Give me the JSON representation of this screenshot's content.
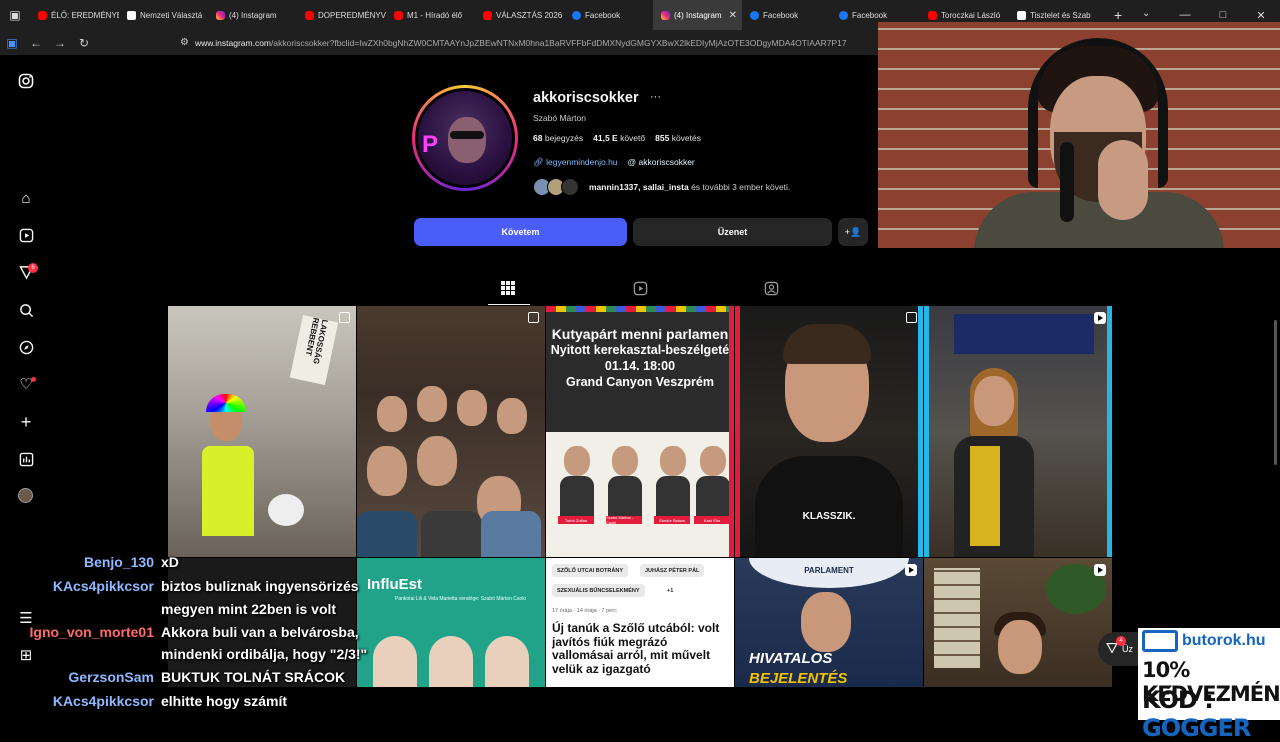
{
  "browser": {
    "tabs": [
      {
        "label": "ÉLŐ: EREDMÉNYE",
        "icon": "youtube-icon"
      },
      {
        "label": "Nemzeti Választá",
        "icon": "doc-icon"
      },
      {
        "label": "(4) Instagram",
        "icon": "instagram-icon"
      },
      {
        "label": "DOPEREDMÉNYV",
        "icon": "youtube-icon"
      },
      {
        "label": "M1 - Híradó élő",
        "icon": "youtube-icon"
      },
      {
        "label": "VÁLASZTÁS 2026",
        "icon": "youtube-icon"
      },
      {
        "label": "Facebook",
        "icon": "facebook-icon"
      },
      {
        "label": "(4) Instagram",
        "icon": "instagram-icon",
        "active": true
      },
      {
        "label": "Facebook",
        "icon": "facebook-icon"
      },
      {
        "label": "Facebook",
        "icon": "facebook-icon"
      },
      {
        "label": "Toroczkai László",
        "icon": "youtube-icon"
      },
      {
        "label": "Tisztelet és Szab",
        "icon": "doc-icon"
      }
    ],
    "url_host": "www.instagram.com",
    "url_path": "/akkoriscsokker?fbclid=IwZXh0bgNhZW0CMTAAYnJpZBEwNTNxM0hna1BaRVFFbFdDMXNydGMGYXBwX2lkEDIyMjAzOTE3ODgyMDA4OTIAAR7P17"
  },
  "profile": {
    "username": "akkoriscsokker",
    "more": "···",
    "full_name": "Szabó Márton",
    "posts_count": "68",
    "posts_label": "bejegyzés",
    "followers_count": "41,5 E",
    "followers_label": "követő",
    "following_count": "855",
    "following_label": "követés",
    "link_label": "legyenmindenjo.hu",
    "threads_label": "akkoriscsokker",
    "followed_names": "mannin1337, sallai_insta",
    "followed_rest": " és további 3 ember követi."
  },
  "actions": {
    "follow_label": "Követem",
    "message_label": "Üzenet",
    "add_label": "+👤"
  },
  "posts": {
    "p1_sign": "LAKOSSÁG REBBENT",
    "p3_line1": "Kutyapárt menni parlamen",
    "p3_line2": "Nyitott kerekasztal-beszélgeté",
    "p3_line3": "01.14. 18:00",
    "p3_line4": "Grand Canyon Veszprém",
    "p3_tags": [
      "Torbó Zoltán",
      "Szabó Márton - Csoki",
      "Sándor Balázs",
      "Kató Ella"
    ],
    "p4_caption": "KLASSZIK.",
    "p6_logo": "InfluEst",
    "p6_sub": "Pankotai Lili & Vida Marietta vendége: Szabó Márton Csoki",
    "p7_pills": [
      "SZŐLŐ UTCAI BOTRÁNY",
      "JUHÁSZ PÉTER PÁL",
      "SZEXUÁLIS BŰNCSELEKMÉNY",
      "+1"
    ],
    "p7_meta": "17 órája   ·   14 órája   ·   7 perc",
    "p7_headline": "Új tanúk a Szőlő utcából: volt javítós fiúk megrázó vallomásai arról, mit művelt velük az igazgató",
    "p8_seal": "PARLAMENT",
    "p8_line1": "HIVATALOS",
    "p8_line2": "BEJELENTÉS"
  },
  "sidebar": {
    "notifications_badge": "6"
  },
  "messages_badge": "4",
  "messages_label": "Üz",
  "chat": [
    {
      "name": "Benjo_130",
      "color": "#8fb8ff",
      "msg": "xD"
    },
    {
      "name": "KAcs4pikkcsor",
      "color": "#8fb8ff",
      "msg": "biztos buliznak ingyensörizés"
    },
    {
      "name": "",
      "color": "#8fb8ff",
      "msg": "megyen mint 22ben is volt"
    },
    {
      "name": "Igno_von_morte01",
      "color": "#ff6b6b",
      "msg": "Akkora buli van a belvárosba,"
    },
    {
      "name": "",
      "color": "#ff6b6b",
      "msg": "mindenki ordibálja, hogy \"2/3!\""
    },
    {
      "name": "GerzsonSam",
      "color": "#8fb8ff",
      "msg": "BUKTUK TOLNÁT SRÁCOK"
    },
    {
      "name": "KAcs4pikkcsor",
      "color": "#8fb8ff",
      "msg": "elhitte hogy számít"
    }
  ],
  "promo": {
    "brand": "butorok.hu",
    "discount": "10% KEDVEZMÉNY",
    "code_label": "KÓD : ",
    "code": "GOGGER"
  },
  "window_controls": [
    "—",
    "□",
    "✕"
  ]
}
